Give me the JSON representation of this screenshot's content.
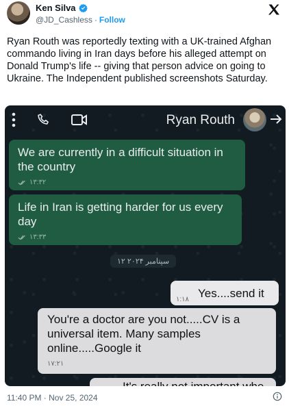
{
  "author": {
    "name": "Ken Silva",
    "handle": "@JD_Cashless",
    "separator": "·",
    "follow_label": "Follow"
  },
  "tweet": {
    "text": "Ryan Routh was reportedly texting with a UK-trained Afghan commando living in Iran days before his alleged attempt on Donald Trump's life -- giving that person advice on going to Ukraine. The Independent published screenshots Saturday."
  },
  "chat": {
    "contact_name": "Ryan Routh",
    "date_chip": "۱۲ سپتامبر ۲۰۲۴",
    "messages": [
      {
        "text": "We are currently in a difficult situation in the country",
        "time": "۱۳:۳۲",
        "direction": "incoming"
      },
      {
        "text": "Life in Iran is getting harder for us every day",
        "time": "۱۳:۳۳",
        "direction": "incoming"
      },
      {
        "text": "Yes....send it",
        "time": "۱:۱۸",
        "direction": "outgoing"
      },
      {
        "text": "You're a doctor are you not.....CV is a universal item. Many samples online.....Google it",
        "time": "۱۷:۲۱",
        "direction": "outgoing"
      }
    ],
    "partial_text": "It's really not important whe"
  },
  "footer": {
    "timestamp": "11:40 PM · Nov 25, 2024"
  },
  "colors": {
    "accent": "#1d9bf0",
    "chat_bg": "#121b22",
    "incoming_bubble": "#1f5c42",
    "outgoing_bubble": "#e9e9eb"
  },
  "icons": [
    "verified-badge-icon",
    "x-logo-icon",
    "more-vert-icon",
    "phone-icon",
    "video-icon",
    "arrow-right-icon",
    "read-check-icon",
    "info-icon"
  ]
}
